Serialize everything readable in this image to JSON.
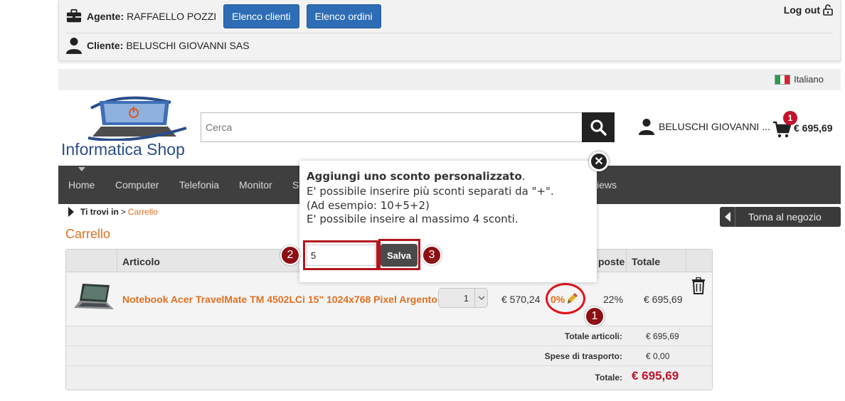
{
  "agent_panel": {
    "agent_label": "Agente:",
    "agent_name": "RAFFAELLO POZZI",
    "btn_clients": "Elenco clienti",
    "btn_orders": "Elenco ordini",
    "client_label": "Cliente:",
    "client_name": "BELUSCHI GIOVANNI SAS",
    "logout": "Log out"
  },
  "language": "Italiano",
  "header": {
    "logo_text": "Informatica Shop",
    "search_placeholder": "Cerca",
    "user_name": "BELUSCHI GIOVANNI ...",
    "cart_count": "1",
    "cart_total": "€ 695,69"
  },
  "nav": [
    "Home",
    "Computer",
    "Telefonia",
    "Monitor",
    "S",
    "iews"
  ],
  "breadcrumb": {
    "prefix": "Ti trovi in",
    "sep": ">",
    "current": "Carrello"
  },
  "back_button": "Torna al negozio",
  "page_title": "Carrello",
  "cart": {
    "headers": {
      "article": "Articolo",
      "taxes": "poste",
      "total": "Totale"
    },
    "item": {
      "name": "Notebook Acer TravelMate TM 4502LCi 15\" 1024x768 Pixel Argento",
      "quantity": "1",
      "price": "€ 570,24",
      "discount": "0%",
      "tax": "22%",
      "total": "€ 695,69"
    },
    "summary": {
      "items_label": "Totale articoli:",
      "items_value": "€ 695,69",
      "shipping_label": "Spese di trasporto:",
      "shipping_value": "€ 0,00",
      "total_label": "Totale:",
      "total_value": "€ 695,69"
    }
  },
  "modal": {
    "title_bold": "Aggiungi uno sconto personalizzato",
    "title_end": ".",
    "line1": "E' possibile inserire più sconti separati da \"+\".",
    "line2": "(Ad esempio: 10+5+2)",
    "line3": "E' possibile inseire al massimo 4 sconti.",
    "input_value": "5",
    "save_label": "Salva",
    "close_glyph": "✕"
  },
  "steps": [
    "1",
    "2",
    "3"
  ],
  "colors": {
    "accent_orange": "#e07020",
    "brand_blue": "#2e6db5",
    "marker_red": "#8c0f14",
    "price_red": "#c0122a"
  }
}
